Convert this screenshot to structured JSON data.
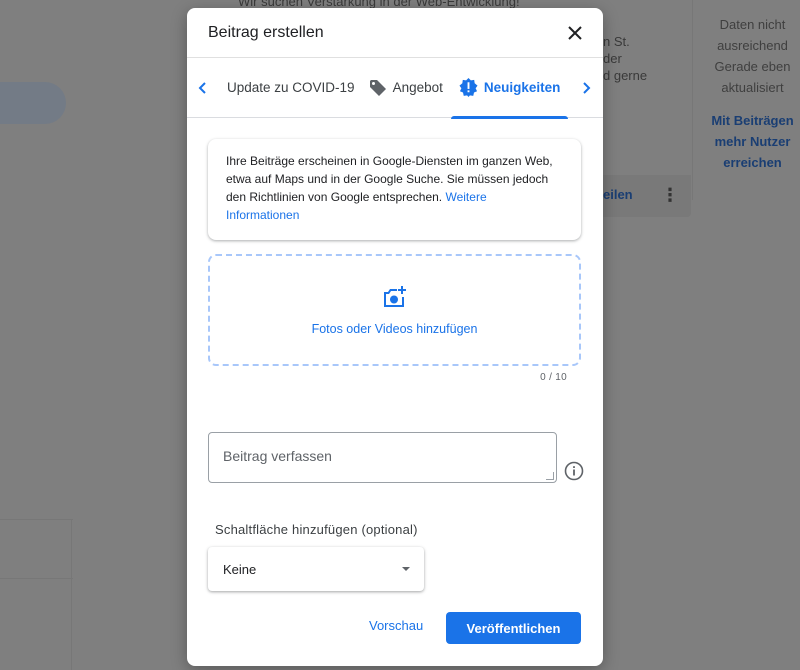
{
  "background": {
    "top_snippet": "Wir suchen Verstärkung in der Web-Entwicklung!",
    "mid_lines": [
      "n St.",
      "der",
      "d gerne"
    ],
    "right_panel": {
      "lines": [
        "Daten nicht",
        "ausreichend",
        "Gerade eben",
        "aktualisiert"
      ],
      "link_lines": [
        "Mit Beiträgen",
        "mehr Nutzer",
        "erreichen"
      ]
    },
    "share_label": "eilen",
    "more_icon": "more-vert-icon"
  },
  "modal": {
    "title": "Beitrag erstellen",
    "close_icon": "close-icon",
    "tabs": [
      {
        "label": "Update zu COVID-19",
        "icon": "",
        "active": false
      },
      {
        "label": "Angebot",
        "icon": "tag-icon",
        "active": false
      },
      {
        "label": "Neuigkeiten",
        "icon": "news-badge-icon",
        "active": true
      }
    ],
    "info": {
      "text": "Ihre Beiträge erscheinen in Google-Diensten im ganzen Web, etwa auf Maps und in der Google Suche. Sie müssen jedoch den Richtlinien von Google entsprechen.",
      "link": "Weitere Informationen"
    },
    "upload": {
      "label": "Fotos oder Videos hinzufügen",
      "icon": "add-photo-icon",
      "counter": "0 / 10"
    },
    "compose": {
      "placeholder": "Beitrag verfassen",
      "value": ""
    },
    "button_section": {
      "label": "Schaltfläche hinzufügen (optional)",
      "selected": "Keine"
    },
    "actions": {
      "preview": "Vorschau",
      "publish": "Veröffentlichen"
    },
    "colors": {
      "accent": "#1a73e8",
      "overlay": "#7f7f7f"
    }
  }
}
